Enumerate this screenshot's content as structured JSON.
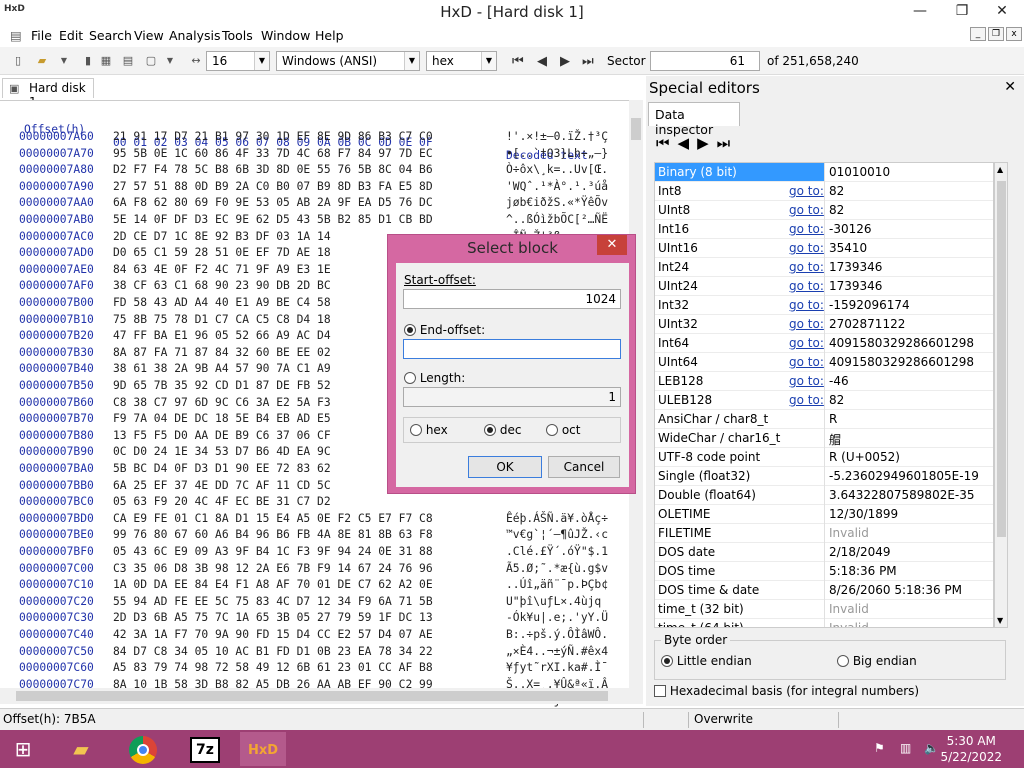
{
  "window": {
    "title": "HxD - [Hard disk 1]",
    "app_icon": "hxd-icon",
    "minimize": "—",
    "restore": "❐",
    "close": "✕"
  },
  "menu": [
    "File",
    "Edit",
    "Search",
    "View",
    "Analysis",
    "Tools",
    "Window",
    "Help"
  ],
  "toolbar": {
    "columns": "16",
    "charset": "Windows (ANSI)",
    "offset_base": "hex",
    "sector_label": "Sector",
    "sector_value": "61",
    "sector_total": "of 251,658,240"
  },
  "tab": {
    "label": "Hard disk 1"
  },
  "hex": {
    "header_offset": "Offset(h)",
    "header_cols": "00 01 02 03 04 05 06 07 08 09 0A 0B 0C 0D 0E 0F",
    "header_decoded": "Decoded text",
    "rows": [
      {
        "off": "00000007A60",
        "bytes": "21 91 17 D7 21 B1 97 30 1D EF 8E 9D 86 B3 C7 C0",
        "dec": "!'.×!±—0.ïŽ.†³Ç"
      },
      {
        "off": "00000007A70",
        "bytes": "95 5B 0E 1C 60 86 4F 33 7D 4C 68 F7 84 97 7D EC",
        "dec": "•[..`†O3}Lh÷„—}"
      },
      {
        "off": "00000007A80",
        "bytes": "D2 F7 F4 78 5C B8 6B 3D 8D 0E 55 76 5B 8C 04 B6",
        "dec": "Ò÷ôx\\¸k=..Uv[Œ."
      },
      {
        "off": "00000007A90",
        "bytes": "27 57 51 88 0D B9 2A C0 B0 07 B9 8D B3 FA E5 8D",
        "dec": "'WQˆ.¹*À°.¹.³úå"
      },
      {
        "off": "00000007AA0",
        "bytes": "6A F8 62 80 69 F0 9E 53 05 AB 2A 9F EA D5 76 DC",
        "dec": "jøb€iðžS.«*ŸêÕv"
      },
      {
        "off": "00000007AB0",
        "bytes": "5E 14 0F DF D3 EC 9E 62 D5 43 5B B2 85 D1 CB BD",
        "dec": "^..ßÓìžbÕC[²…ÑË"
      },
      {
        "off": "00000007AC0",
        "bytes": "2D CE D7 1C 8E 92 B3 DF 03 1A 14 ",
        "dec": "-ÎÑ.Ž'³ß..."
      },
      {
        "off": "00000007AD0",
        "bytes": "D0 65 C1 59 28 51 0E EF 7D AE 18 ",
        "dec": ""
      },
      {
        "off": "00000007AE0",
        "bytes": "84 63 4E 0F F2 4C 71 9F A9 E3 1E ",
        "dec": ""
      },
      {
        "off": "00000007AF0",
        "bytes": "38 CF 63 C1 68 90 23 90 DB 2D BC ",
        "dec": ""
      },
      {
        "off": "00000007B00",
        "bytes": "FD 58 43 AD A4 40 E1 A9 BE C4 58 ",
        "dec": ""
      },
      {
        "off": "00000007B10",
        "bytes": "75 8B 75 78 D1 C7 CA C5 C8 D4 18 ",
        "dec": ""
      },
      {
        "off": "00000007B20",
        "bytes": "47 FF BA E1 96 05 52 66 A9 AC D4 ",
        "dec": ""
      },
      {
        "off": "00000007B30",
        "bytes": "8A 87 FA 71 87 84 32 60 BE EE 02 ",
        "dec": ""
      },
      {
        "off": "00000007B40",
        "bytes": "38 61 38 2A 9B A4 57 90 7A C1 A9 ",
        "dec": ""
      },
      {
        "off": "00000007B50",
        "bytes": "9D 65 7B 35 92 CD D1 87 DE FB 52 ",
        "dec": ""
      },
      {
        "off": "00000007B60",
        "bytes": "C8 38 C7 97 6D 9C C6 3A E2 5A F3 ",
        "dec": ""
      },
      {
        "off": "00000007B70",
        "bytes": "F9 7A 04 DE DC 18 5E B4 EB AD E5 ",
        "dec": ""
      },
      {
        "off": "00000007B80",
        "bytes": "13 F5 F5 D0 AA DE B9 C6 37 06 CF ",
        "dec": ""
      },
      {
        "off": "00000007B90",
        "bytes": "0C D0 24 1E 34 53 D7 B6 4D EA 9C ",
        "dec": ""
      },
      {
        "off": "00000007BA0",
        "bytes": "5B BC D4 0F D3 D1 90 EE 72 83 62 ",
        "dec": ""
      },
      {
        "off": "00000007BB0",
        "bytes": "6A 25 EF 37 4E DD 7C AF 11 CD 5C ",
        "dec": ""
      },
      {
        "off": "00000007BC0",
        "bytes": "05 63 F9 20 4C 4F EC BE 31 C7 D2 ",
        "dec": ""
      },
      {
        "off": "00000007BD0",
        "bytes": "CA E9 FE 01 C1 8A D1 15 E4 A5 0E F2 C5 E7 F7 C8",
        "dec": "Êéþ.ÁŠÑ.ä¥.òÅç÷"
      },
      {
        "off": "00000007BE0",
        "bytes": "99 76 80 67 60 A6 B4 96 B6 FB 4A 8E 81 8B 63 F8",
        "dec": "™v€g`¦´–¶ûJŽ.‹c"
      },
      {
        "off": "00000007BF0",
        "bytes": "05 43 6C E9 09 A3 9F B4 1C F3 9F 94 24 0E 31 88",
        "dec": ".Clé.£Ÿ´.óŸ\"$.1"
      },
      {
        "off": "00000007C00",
        "bytes": "C3 35 06 D8 3B 98 12 2A E6 7B F9 14 67 24 76 96",
        "dec": "Ã5.Ø;˜.*æ{ù.g$v"
      },
      {
        "off": "00000007C10",
        "bytes": "1A 0D DA EE 84 E4 F1 A8 AF 70 01 DE C7 62 A2 0E",
        "dec": "..Úî„äñ¨¯p.ÞÇb¢"
      },
      {
        "off": "00000007C20",
        "bytes": "55 94 AD FE EE 5C 75 83 4C D7 12 34 F9 6A 71 5B",
        "dec": "U\"­þî\\uƒL×.4ùjq"
      },
      {
        "off": "00000007C30",
        "bytes": "2D D3 6B A5 75 7C 1A 65 3B 05 27 79 59 1F DC 13",
        "dec": "-Ók¥u|.e;.'yY.Ü"
      },
      {
        "off": "00000007C40",
        "bytes": "42 3A 1A F7 70 9A 90 FD 15 D4 CC E2 57 D4 07 AE",
        "dec": "B:.÷pš.ý.ÔÌâWÔ."
      },
      {
        "off": "00000007C50",
        "bytes": "84 D7 C8 34 05 10 AC B1 FD D1 0B 23 EA 78 34 22",
        "dec": "„×È4..¬±ýÑ.#êx4"
      },
      {
        "off": "00000007C60",
        "bytes": "A5 83 79 74 98 72 58 49 12 6B 61 23 01 CC AF B8",
        "dec": "¥ƒyt˜rXI.ka#.Ì¯"
      },
      {
        "off": "00000007C70",
        "bytes": "8A 10 1B 58 3D B8 82 A5 DB 26 AA AB EF 90 C2 99",
        "dec": "Š..X=¸‚¥Û&ª«ï.Â"
      },
      {
        "off": "00000007C80",
        "bytes": "BA 7E 76 BB 25 75 09 6A BA C8 12 13 DE B3 A4 8E",
        "dec": "º~v»%u.jºÈ..Þ³¤"
      }
    ]
  },
  "status": {
    "offset": "Offset(h): 7B5A",
    "mode": "Overwrite"
  },
  "special": {
    "title": "Special editors",
    "close": "✕",
    "tab": "Data inspector",
    "rows": [
      {
        "label": "Binary (8 bit)",
        "goto": "",
        "value": "01010010",
        "selected": true
      },
      {
        "label": "Int8",
        "goto": "go to:",
        "value": "82"
      },
      {
        "label": "UInt8",
        "goto": "go to:",
        "value": "82"
      },
      {
        "label": "Int16",
        "goto": "go to:",
        "value": "-30126"
      },
      {
        "label": "UInt16",
        "goto": "go to:",
        "value": "35410"
      },
      {
        "label": "Int24",
        "goto": "go to:",
        "value": "1739346"
      },
      {
        "label": "UInt24",
        "goto": "go to:",
        "value": "1739346"
      },
      {
        "label": "Int32",
        "goto": "go to:",
        "value": "-1592096174"
      },
      {
        "label": "UInt32",
        "goto": "go to:",
        "value": "2702871122"
      },
      {
        "label": "Int64",
        "goto": "go to:",
        "value": "4091580329286601298"
      },
      {
        "label": "UInt64",
        "goto": "go to:",
        "value": "4091580329286601298"
      },
      {
        "label": "LEB128",
        "goto": "go to:",
        "value": "-46"
      },
      {
        "label": "ULEB128",
        "goto": "go to:",
        "value": "82"
      },
      {
        "label": "AnsiChar / char8_t",
        "goto": "",
        "value": "R"
      },
      {
        "label": "WideChar / char16_t",
        "goto": "",
        "value": "艒"
      },
      {
        "label": "UTF-8 code point",
        "goto": "",
        "value": "R (U+0052)"
      },
      {
        "label": "Single (float32)",
        "goto": "",
        "value": "-5.23602949601805E-19"
      },
      {
        "label": "Double (float64)",
        "goto": "",
        "value": "3.64322807589802E-35"
      },
      {
        "label": "OLETIME",
        "goto": "",
        "value": "12/30/1899"
      },
      {
        "label": "FILETIME",
        "goto": "",
        "value": "Invalid",
        "gray": true
      },
      {
        "label": "DOS date",
        "goto": "",
        "value": "2/18/2049"
      },
      {
        "label": "DOS time",
        "goto": "",
        "value": "5:18:36 PM"
      },
      {
        "label": "DOS time & date",
        "goto": "",
        "value": "8/26/2060 5:18:36 PM"
      },
      {
        "label": "time_t (32 bit)",
        "goto": "",
        "value": "Invalid",
        "gray": true
      },
      {
        "label": "time_t (64 bit)",
        "goto": "",
        "value": "Invalid",
        "gray": true
      }
    ],
    "byte_order": "Byte order",
    "little_endian": "Little endian",
    "big_endian": "Big endian",
    "hex_basis": "Hexadecimal basis (for integral numbers)"
  },
  "dialog": {
    "title": "Select block",
    "start_label": "Start-offset:",
    "start_value": "1024",
    "end_label": "End-offset:",
    "end_value": "",
    "length_label": "Length:",
    "length_value": "1",
    "radix_hex": "hex",
    "radix_dec": "dec",
    "radix_oct": "oct",
    "ok": "OK",
    "cancel": "Cancel"
  },
  "taskbar": {
    "apps": [
      "windows-start-icon",
      "file-explorer-icon",
      "chrome-icon",
      "7zip-icon",
      "hxd-icon"
    ],
    "zip_label": "7z",
    "hxd_label": "HxD",
    "time": "5:30 AM",
    "date": "5/22/2022"
  },
  "colors": {
    "taskbar": "#9d3f73",
    "dialog_frame": "#d568a2",
    "selection": "#3399ff",
    "link": "#1a3fb0"
  }
}
